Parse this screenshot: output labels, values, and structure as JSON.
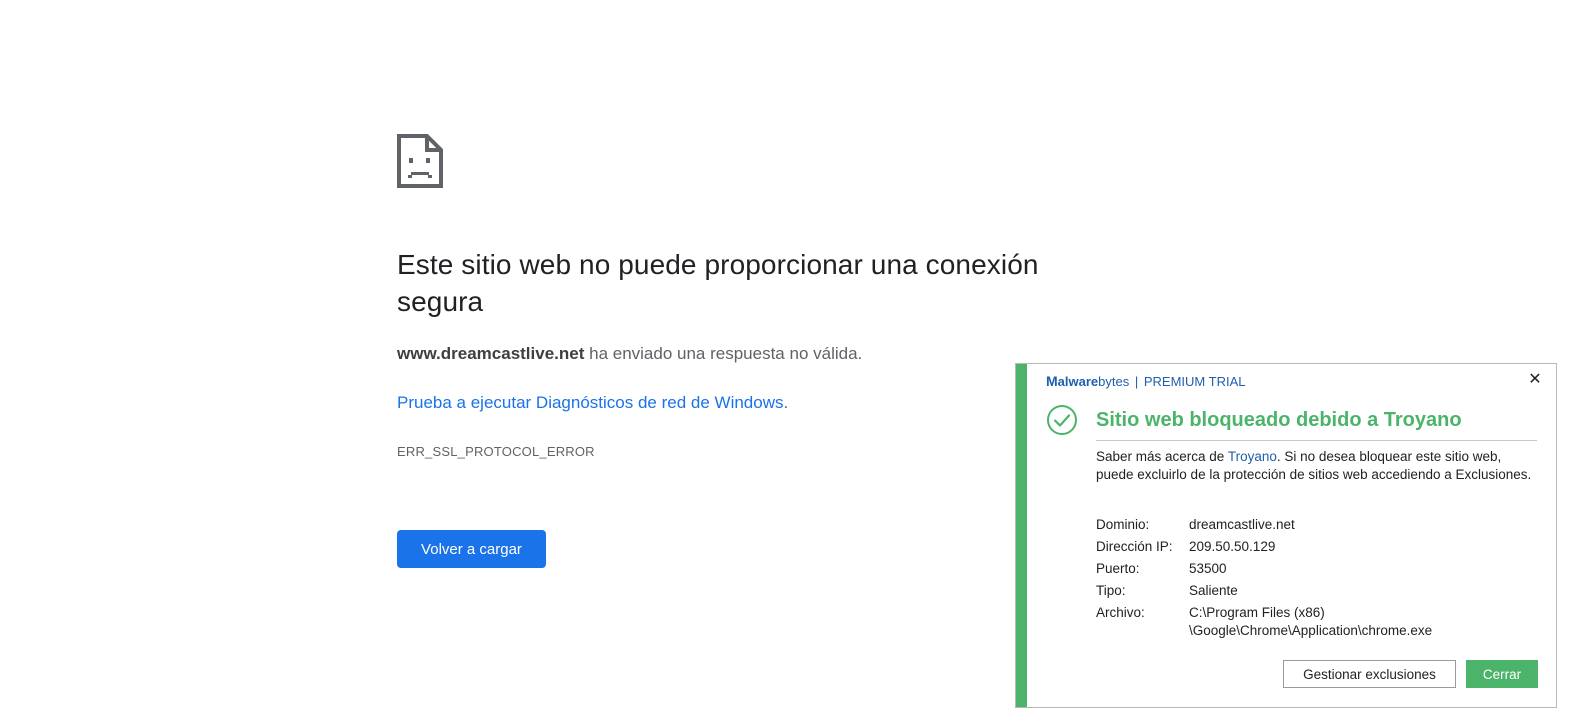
{
  "error_page": {
    "icon": "sad-page-icon",
    "title": "Este sitio web no puede proporcionar una conexión segura",
    "message_domain": "www.dreamcastlive.net",
    "message_rest": " ha enviado una respuesta no válida.",
    "suggestion_link": "Prueba a ejecutar Diagnósticos de red de Windows",
    "suggestion_end": ".",
    "error_code": "ERR_SSL_PROTOCOL_ERROR",
    "reload_button": "Volver a cargar",
    "colors": {
      "button": "#1a73e8",
      "link": "#1a73e8",
      "title": "#202124"
    }
  },
  "malwarebytes": {
    "brand_m": "M",
    "brand_mal": "alware",
    "brand_bytes": "bytes",
    "brand_sep": "|",
    "edition": "PREMIUM TRIAL",
    "close_icon": "close-icon",
    "status_icon": "check-circle-icon",
    "title": "Sitio web bloqueado debido a Troyano",
    "desc_prefix": "Saber más acerca de ",
    "desc_link": "Troyano",
    "desc_suffix": ". Si no desea bloquear este sitio web, puede excluirlo de la protección de sitios web accediendo a Exclusiones.",
    "details": [
      {
        "key": "Dominio:",
        "value": "dreamcastlive.net"
      },
      {
        "key": "Dirección IP:",
        "value": "209.50.50.129"
      },
      {
        "key": "Puerto:",
        "value": "53500"
      },
      {
        "key": "Tipo:",
        "value": "Saliente"
      },
      {
        "key": "Archivo:",
        "value": "C:\\Program Files (x86)\n\\Google\\Chrome\\Application\\chrome.exe"
      }
    ],
    "manage_button": "Gestionar exclusiones",
    "close_button": "Cerrar",
    "colors": {
      "accent": "#4cb46a",
      "brand": "#1f5fad"
    }
  }
}
